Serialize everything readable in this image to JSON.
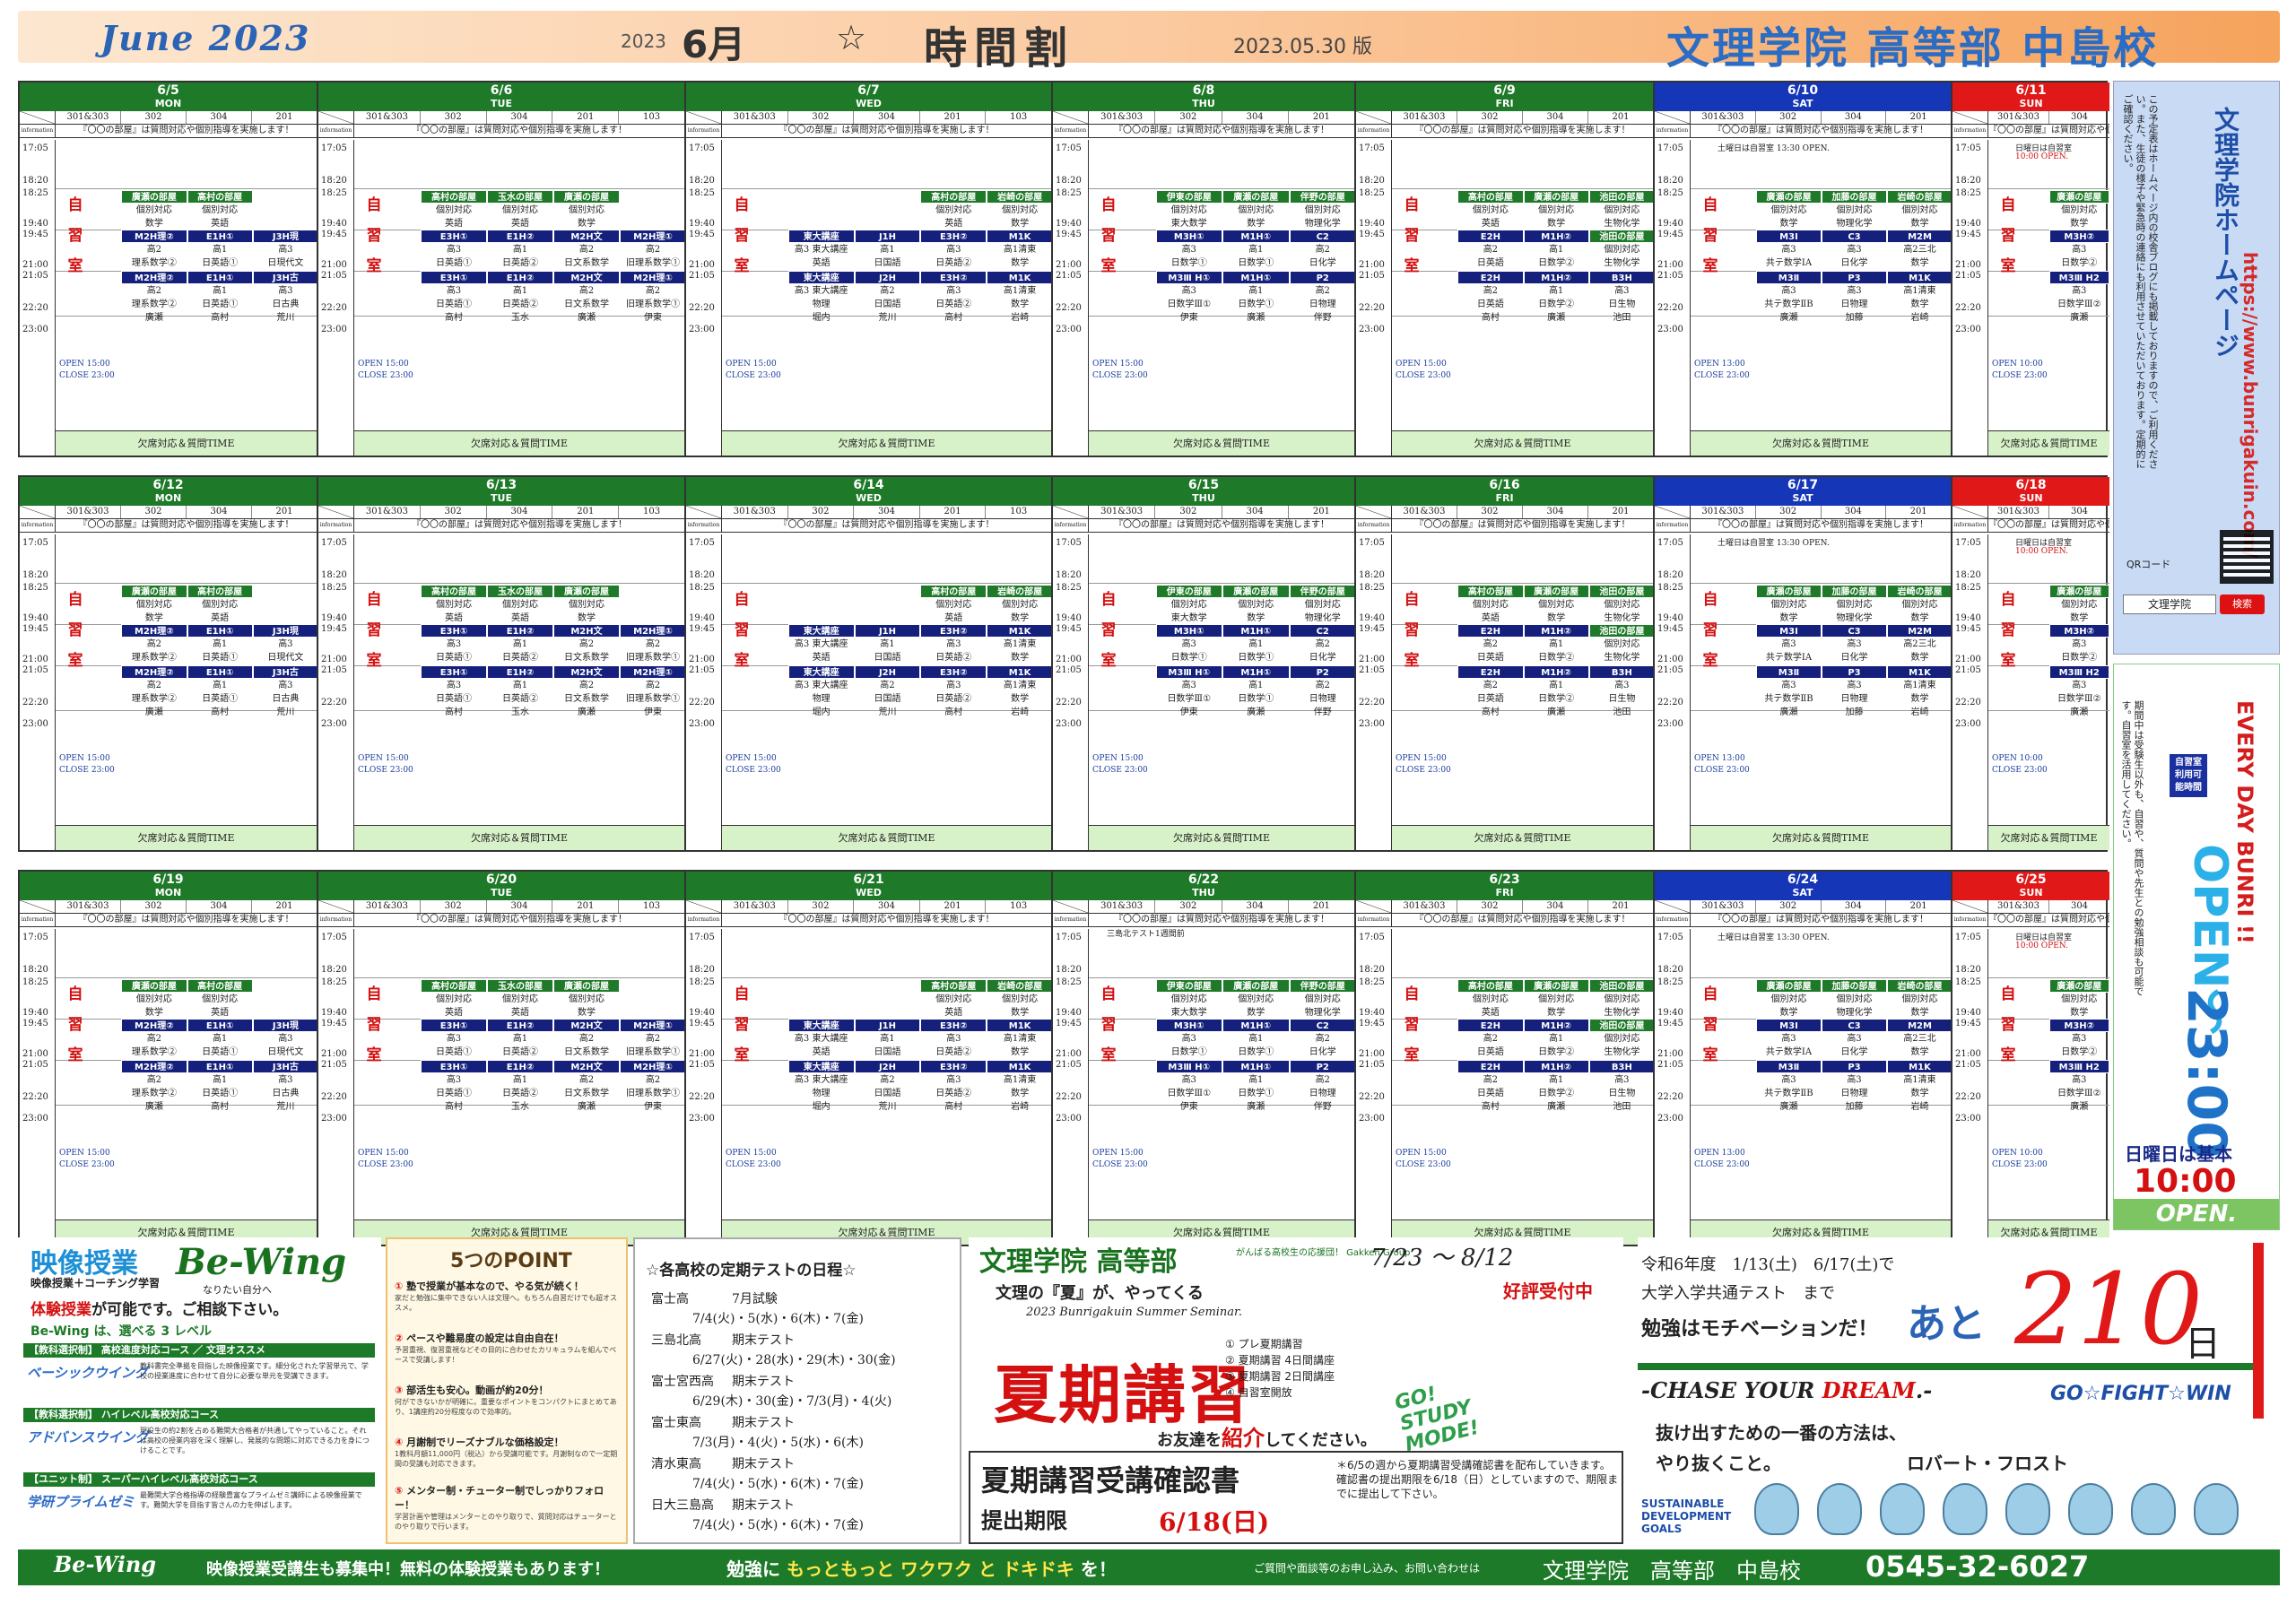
{
  "header": {
    "month_en": "June 2023",
    "year": "2023",
    "month_jp": "6月",
    "star": "☆",
    "title": "時間割",
    "version": "2023.05.30 版",
    "school": "文理学院 高等部 中島校"
  },
  "common": {
    "info_label": "information",
    "info_text": "『〇〇の部屋』は質問対応や個別指導を実施します！",
    "info_sat_line": "土曜日は自習室 13:30 OPEN.",
    "info_sun_line": "日曜日は自習室",
    "info_sun_open": "10:00 OPEN.",
    "jishu": [
      "自",
      "習",
      "室"
    ],
    "open_weekday": "OPEN 15:00",
    "open_sat": "OPEN 13:00",
    "open_sun": "OPEN 10:00",
    "close": "CLOSE 23:00",
    "footer_text": "欠席対応＆質問TIME",
    "test_note": "三島北テスト1週間前"
  },
  "weeks": [
    {
      "days": [
        {
          "date": "6/5",
          "dow": "MON"
        },
        {
          "date": "6/6",
          "dow": "TUE"
        },
        {
          "date": "6/7",
          "dow": "WED"
        },
        {
          "date": "6/8",
          "dow": "THU"
        },
        {
          "date": "6/9",
          "dow": "FRI"
        },
        {
          "date": "6/10",
          "dow": "SAT"
        },
        {
          "date": "6/11",
          "dow": "SUN"
        }
      ]
    },
    {
      "days": [
        {
          "date": "6/12",
          "dow": "MON"
        },
        {
          "date": "6/13",
          "dow": "TUE"
        },
        {
          "date": "6/14",
          "dow": "WED"
        },
        {
          "date": "6/15",
          "dow": "THU"
        },
        {
          "date": "6/16",
          "dow": "FRI"
        },
        {
          "date": "6/17",
          "dow": "SAT"
        },
        {
          "date": "6/18",
          "dow": "SUN"
        }
      ]
    },
    {
      "days": [
        {
          "date": "6/19",
          "dow": "MON"
        },
        {
          "date": "6/20",
          "dow": "TUE"
        },
        {
          "date": "6/21",
          "dow": "WED"
        },
        {
          "date": "6/22",
          "dow": "THU"
        },
        {
          "date": "6/23",
          "dow": "FRI"
        },
        {
          "date": "6/24",
          "dow": "SAT"
        },
        {
          "date": "6/25",
          "dow": "SUN"
        }
      ]
    }
  ],
  "day_templates": {
    "MON": {
      "rooms": [
        "301&303",
        "302",
        "304",
        "201"
      ],
      "times": [
        "17:05",
        "18:20",
        "18:25",
        "19:40",
        "19:45",
        "21:00",
        "21:05",
        "22:20",
        "23:00"
      ],
      "blocks": [
        [
          null,
          {
            "h": "廣瀬の部屋",
            "c": "green",
            "l": [
              "個別対応",
              "数学",
              "廣瀬"
            ]
          },
          {
            "h": "高村の部屋",
            "c": "green",
            "l": [
              "個別対応",
              "英語",
              "高村"
            ]
          },
          null
        ],
        [
          null,
          {
            "h": "M2H理②",
            "c": "navy",
            "l": [
              "高2",
              "理系数学②",
              "廣瀬"
            ]
          },
          {
            "h": "E1H①",
            "c": "navy",
            "l": [
              "高1",
              "日英語①",
              "高村"
            ]
          },
          {
            "h": "J3H現",
            "c": "navy",
            "l": [
              "高3",
              "日現代文",
              "荒川"
            ]
          }
        ],
        [
          null,
          {
            "h": "M2H理②",
            "c": "navy",
            "l": [
              "高2",
              "理系数学②",
              "廣瀬"
            ]
          },
          {
            "h": "E1H①",
            "c": "navy",
            "l": [
              "高1",
              "日英語①",
              "高村"
            ]
          },
          {
            "h": "J3H古",
            "c": "navy",
            "l": [
              "高3",
              "日古典",
              "荒川"
            ]
          }
        ]
      ]
    },
    "TUE": {
      "rooms": [
        "301&303",
        "302",
        "304",
        "201",
        "103"
      ],
      "times": [
        "17:05",
        "18:20",
        "18:25",
        "19:40",
        "19:45",
        "21:00",
        "21:05",
        "22:20",
        "23:00"
      ],
      "blocks": [
        [
          null,
          {
            "h": "高村の部屋",
            "c": "green",
            "l": [
              "個別対応",
              "英語",
              "高村"
            ]
          },
          {
            "h": "玉水の部屋",
            "c": "green",
            "l": [
              "個別対応",
              "英語",
              "玉水"
            ]
          },
          {
            "h": "廣瀬の部屋",
            "c": "green",
            "l": [
              "個別対応",
              "数学",
              "廣瀬"
            ]
          },
          null
        ],
        [
          null,
          {
            "h": "E3H①",
            "c": "navy",
            "l": [
              "高3",
              "日英語①",
              "高村"
            ]
          },
          {
            "h": "E1H②",
            "c": "navy",
            "l": [
              "高1",
              "日英語②",
              "玉水"
            ]
          },
          {
            "h": "M2H文",
            "c": "navy",
            "l": [
              "高2",
              "日文系数学",
              "廣瀬"
            ]
          },
          {
            "h": "M2H理①",
            "c": "navy",
            "l": [
              "高2",
              "旧理系数学①",
              "伊東"
            ]
          }
        ],
        [
          null,
          {
            "h": "E3H①",
            "c": "navy",
            "l": [
              "高3",
              "日英語①",
              "高村"
            ]
          },
          {
            "h": "E1H②",
            "c": "navy",
            "l": [
              "高1",
              "日英語②",
              "玉水"
            ]
          },
          {
            "h": "M2H文",
            "c": "navy",
            "l": [
              "高2",
              "日文系数学",
              "廣瀬"
            ]
          },
          {
            "h": "M2H理①",
            "c": "navy",
            "l": [
              "高2",
              "旧理系数学①",
              "伊東"
            ]
          }
        ]
      ]
    },
    "WED": {
      "rooms": [
        "301&303",
        "302",
        "304",
        "201",
        "103"
      ],
      "times": [
        "17:05",
        "18:20",
        "18:25",
        "19:40",
        "19:45",
        "21:00",
        "21:05",
        "22:20",
        "23:00"
      ],
      "blocks": [
        [
          null,
          null,
          null,
          {
            "h": "高村の部屋",
            "c": "green",
            "l": [
              "個別対応",
              "英語",
              "高村"
            ]
          },
          {
            "h": "岩崎の部屋",
            "c": "green",
            "l": [
              "個別対応",
              "数学",
              "岩崎"
            ]
          }
        ],
        [
          null,
          {
            "h": "東大講座",
            "c": "navy",
            "l": [
              "高3 東大講座",
              "英語",
              "一瀬"
            ]
          },
          {
            "h": "J1H",
            "c": "navy",
            "l": [
              "高1",
              "日国語",
              "荒川"
            ]
          },
          {
            "h": "E3H②",
            "c": "navy",
            "l": [
              "高3",
              "日英語②",
              "高村"
            ]
          },
          {
            "h": "M1K",
            "c": "navy",
            "l": [
              "高1清東",
              "数学",
              "岩崎"
            ]
          }
        ],
        [
          null,
          {
            "h": "東大講座",
            "c": "navy",
            "l": [
              "高3 東大講座",
              "物理",
              "堀内"
            ]
          },
          {
            "h": "J2H",
            "c": "navy",
            "l": [
              "高2",
              "日国語",
              "荒川"
            ]
          },
          {
            "h": "E3H②",
            "c": "navy",
            "l": [
              "高3",
              "日英語②",
              "高村"
            ]
          },
          {
            "h": "M1K",
            "c": "navy",
            "l": [
              "高1清東",
              "数学",
              "岩崎"
            ]
          }
        ]
      ]
    },
    "THU": {
      "rooms": [
        "301&303",
        "302",
        "304",
        "201"
      ],
      "times": [
        "17:05",
        "18:20",
        "18:25",
        "19:40",
        "19:45",
        "21:00",
        "21:05",
        "22:20",
        "23:00"
      ],
      "blocks": [
        [
          null,
          {
            "h": "伊東の部屋",
            "c": "green",
            "l": [
              "個別対応",
              "東大数学",
              "伊東"
            ]
          },
          {
            "h": "廣瀬の部屋",
            "c": "green",
            "l": [
              "個別対応",
              "数学",
              "廣瀬"
            ]
          },
          {
            "h": "伴野の部屋",
            "c": "green",
            "l": [
              "個別対応",
              "物理化学",
              "伴野"
            ]
          }
        ],
        [
          null,
          {
            "h": "M3H①",
            "c": "navy",
            "l": [
              "高3",
              "日数学①",
              "伊東"
            ]
          },
          {
            "h": "M1H①",
            "c": "navy",
            "l": [
              "高1",
              "日数学①",
              "廣瀬"
            ]
          },
          {
            "h": "C2",
            "c": "navy",
            "l": [
              "高2",
              "日化学",
              "伴野"
            ]
          }
        ],
        [
          null,
          {
            "h": "M3Ⅲ H①",
            "c": "navy",
            "l": [
              "高3",
              "日数学Ⅲ①",
              "伊東"
            ]
          },
          {
            "h": "M1H①",
            "c": "navy",
            "l": [
              "高1",
              "日数学①",
              "廣瀬"
            ]
          },
          {
            "h": "P2",
            "c": "navy",
            "l": [
              "高2",
              "日物理",
              "伴野"
            ]
          }
        ]
      ]
    },
    "FRI": {
      "rooms": [
        "301&303",
        "302",
        "304",
        "201"
      ],
      "times": [
        "17:05",
        "18:20",
        "18:25",
        "19:40",
        "19:45",
        "21:00",
        "21:05",
        "22:20",
        "23:00"
      ],
      "blocks": [
        [
          null,
          {
            "h": "高村の部屋",
            "c": "green",
            "l": [
              "個別対応",
              "英語",
              "高村"
            ]
          },
          {
            "h": "廣瀬の部屋",
            "c": "green",
            "l": [
              "個別対応",
              "数学",
              "廣瀬"
            ]
          },
          {
            "h": "池田の部屋",
            "c": "green",
            "l": [
              "個別対応",
              "生物化学",
              "池田"
            ]
          }
        ],
        [
          null,
          {
            "h": "E2H",
            "c": "navy",
            "l": [
              "高2",
              "日英語",
              "高村"
            ]
          },
          {
            "h": "M1H②",
            "c": "navy",
            "l": [
              "高1",
              "日数学②",
              "廣瀬"
            ]
          },
          {
            "h": "池田の部屋",
            "c": "green",
            "l": [
              "個別対応",
              "生物化学",
              "池田"
            ]
          }
        ],
        [
          null,
          {
            "h": "E2H",
            "c": "navy",
            "l": [
              "高2",
              "日英語",
              "高村"
            ]
          },
          {
            "h": "M1H②",
            "c": "navy",
            "l": [
              "高1",
              "日数学②",
              "廣瀬"
            ]
          },
          {
            "h": "B3H",
            "c": "navy",
            "l": [
              "高3",
              "日生物",
              "池田"
            ]
          }
        ]
      ]
    },
    "SAT": {
      "rooms": [
        "301&303",
        "302",
        "304",
        "201"
      ],
      "times": [
        "17:05",
        "18:20",
        "18:25",
        "19:40",
        "19:45",
        "21:00",
        "21:05",
        "22:20",
        "23:00"
      ],
      "blocks": [
        [
          null,
          {
            "h": "廣瀬の部屋",
            "c": "green",
            "l": [
              "個別対応",
              "数学",
              "廣瀬"
            ]
          },
          {
            "h": "加藤の部屋",
            "c": "green",
            "l": [
              "個別対応",
              "物理化学",
              "加藤"
            ]
          },
          {
            "h": "岩崎の部屋",
            "c": "green",
            "l": [
              "個別対応",
              "数学",
              "岩崎"
            ]
          }
        ],
        [
          null,
          {
            "h": "M3Ⅰ",
            "c": "navy",
            "l": [
              "高3",
              "共テ数学ⅠA",
              "廣瀬"
            ]
          },
          {
            "h": "C3",
            "c": "navy",
            "l": [
              "高3",
              "日化学",
              "加藤"
            ]
          },
          {
            "h": "M2M",
            "c": "navy",
            "l": [
              "高2三北",
              "数学",
              "岩崎"
            ]
          }
        ],
        [
          null,
          {
            "h": "M3Ⅱ",
            "c": "navy",
            "l": [
              "高3",
              "共テ数学ⅡB",
              "廣瀬"
            ]
          },
          {
            "h": "P3",
            "c": "navy",
            "l": [
              "高3",
              "日物理",
              "加藤"
            ]
          },
          {
            "h": "M1K",
            "c": "navy",
            "l": [
              "高1清東",
              "数学",
              "岩崎"
            ]
          }
        ]
      ]
    },
    "SUN": {
      "rooms": [
        "301&303",
        "304"
      ],
      "times": [
        "17:05",
        "18:20",
        "18:25",
        "19:40",
        "19:45",
        "21:00",
        "21:05",
        "22:20",
        "23:00"
      ],
      "blocks": [
        [
          null,
          {
            "h": "廣瀬の部屋",
            "c": "green",
            "l": [
              "個別対応",
              "数学",
              "廣瀬"
            ]
          }
        ],
        [
          null,
          {
            "h": "M3H②",
            "c": "navy",
            "l": [
              "高3",
              "日数学②",
              "廣瀬"
            ]
          }
        ],
        [
          null,
          {
            "h": "M3Ⅲ H2",
            "c": "navy",
            "l": [
              "高3",
              "日数学Ⅲ②",
              "廣瀬"
            ]
          }
        ]
      ]
    }
  },
  "sidebar_web": {
    "note": "この予定表はホームページ内の校舎ブログにも掲載しておりますので、ご利用ください。また、生徒の様子や緊急時の連絡にも利用させていただいております。定期的にご確認ください。",
    "title": "文理学院ホームページ",
    "url": "https://www.bunrigakuin.com/",
    "qr_label": "QRコード",
    "search_text": "文理学院",
    "search_button": "検索"
  },
  "sidebar_open": {
    "note": "期間中は受験生以外も、自習や、質問や先生との勉強相談も可能です。自習室を活用してください。",
    "title": "EVERY DAY BUNRI !!",
    "self_study": "自習室利用可能時間",
    "open": "OPEN～",
    "close_time": "23:00",
    "sunday_label": "日曜日は基本",
    "sunday_time": "10:00",
    "open_word": "OPEN."
  },
  "video_panel": {
    "title": "映像授業",
    "subtitle": "映像授業＋コーチング学習",
    "logo": "Be-Wing",
    "tagline": "なりたい自分へ",
    "trial_red": "体験授業",
    "trial_rest": "が可能です。ご相談下さい。",
    "levels_label": "Be-Wing は、選べる 3 レベル",
    "levels": [
      {
        "bar": "【教科選択制】 高校進度対応コース ／ 文理オススメ",
        "name": "ベーシックウイング",
        "desc": "教科書完全準拠を目指した映像授業です。細分化された学習単元で、学校の授業進度に合わせて自分に必要な単元を受講できます。"
      },
      {
        "bar": "【教科選択制】 ハイレベル高校対応コース",
        "name": "アドバンスウイング",
        "desc": "現役生の約2割を占める難関大合格者が共通してやっていること。それは高校の授業内容を深く理解し、発展的な問題に対応できる力を身につけることです。"
      },
      {
        "bar": "【ユニット制】 スーパーハイレベル高校対応コース",
        "name": "学研プライムゼミ",
        "desc": "最難関大学合格指導の経験豊富なプライムゼミ講師による映像授業です。難関大学を目指す皆さんの力を伸ばします。"
      }
    ]
  },
  "point_panel": {
    "title": "5つのPOINT",
    "points": [
      {
        "key": "①",
        "head": "塾で授業が基本なので、やる気が続く！",
        "desc": "家だと勉強に集中できない人は文理へ。もちろん自習だけでも超オススメ。"
      },
      {
        "key": "②",
        "head": "ペースや難易度の設定は自由自在！",
        "desc": "予習重視、復習重視などその目的に合わせたカリキュラムを組んでペースで受講します！"
      },
      {
        "key": "③",
        "head": "部活生も安心。動画が約20分！",
        "desc": "何ができないかが明確に。重要なポイントをコンパクトにまとめてあり、1講座約20分程度なので効率的。"
      },
      {
        "key": "④",
        "head": "月謝制でリーズナブルな価格設定！",
        "desc": "1教科月額11,000円（税込）から受講可能です。月謝制なので一定期間の受講も対応できます。"
      },
      {
        "key": "⑤",
        "head": "メンター制・チューター制でしっかりフォロー！",
        "desc": "学習計画や管理はメンターとのやり取りで、質問対応はチューターとのやり取りで行います。"
      }
    ]
  },
  "tests_panel": {
    "title": "☆各高校の定期テストの日程☆",
    "tests": [
      {
        "school": "富士高",
        "name": "7月試験",
        "dates": "7/4(火)・5(水)・6(木)・7(金)"
      },
      {
        "school": "三島北高",
        "name": "期末テスト",
        "dates": "6/27(火)・28(水)・29(木)・30(金)"
      },
      {
        "school": "富士宮西高",
        "name": "期末テスト",
        "dates": "6/29(木)・30(金)・7/3(月)・4(火)"
      },
      {
        "school": "富士東高",
        "name": "期末テスト",
        "dates": "7/3(月)・4(火)・5(水)・6(木)"
      },
      {
        "school": "清水東高",
        "name": "期末テスト",
        "dates": "7/4(火)・5(水)・6(木)・7(金)"
      },
      {
        "school": "日大三島高",
        "name": "期末テスト",
        "dates": "7/4(火)・5(水)・6(木)・7(金)"
      }
    ]
  },
  "summer_panel": {
    "school": "文理学院 高等部",
    "gakken": "がんばる高校生の応援団！ Gakken Group",
    "dates": "7/23 ～ 8/12",
    "comes": "文理の『夏』が、やってくる",
    "english": "2023 Bunrigakuin Summer Seminar.",
    "big": "夏期講習",
    "list": [
      "① プレ夏期講習",
      "② 夏期講習 4日間講座",
      "③ 夏期講習 2日間講座",
      "④ 自習室開放"
    ],
    "invite_pre": "お友達を",
    "invite_red": "紹介",
    "invite_post": "してください。",
    "stamp": "好評受付中",
    "go_study": "GO! STUDY MODE!",
    "confirm_title": "夏期講習受講確認書",
    "confirm_deadline": "提出期限",
    "confirm_date": "6/18(日)",
    "confirm_note": "＊6/5の週から夏期講習受講確認書を配布していきます。確認書の提出期限を6/18（日）としていますので、期限までに提出して下さい。"
  },
  "count_panel": {
    "line1": "令和6年度　1/13(土)　6/17(土)で",
    "line2": "大学入学共通テスト　まで",
    "line3": "勉強はモチベーションだ！",
    "ato": "あと",
    "days": "210",
    "unit": "日",
    "chase_pre": "-CHASE YOUR ",
    "chase_red": "DREAM",
    "chase_post": ".-",
    "gofight": "GO☆FIGHT☆WIN",
    "quote1": "抜け出すための一番の方法は、",
    "quote2": "やり抜くこと。",
    "quote_author": "ロバート・フロスト",
    "sdg": "SUSTAINABLE DEVELOPMENT GOALS"
  },
  "footer": {
    "logo": "Be-Wing",
    "msg1": "映像授業受講生も募集中！無料の体験授業もあります！",
    "msg2_a": "勉強に ",
    "msg2_b": "もっともっと ワクワク と ドキドキ",
    "msg2_c": " を！",
    "contact": "ご質問や面談等のお申し込み、お問い合わせは",
    "school": "文理学院　高等部　中島校",
    "phone": "0545-32-6027"
  },
  "colors": {
    "green": "#1e7a28",
    "navy": "#14207c",
    "saturday": "#1636b8",
    "sunday": "#e01818",
    "accent_red": "#d41010",
    "header_blue": "#2b6cc4"
  }
}
